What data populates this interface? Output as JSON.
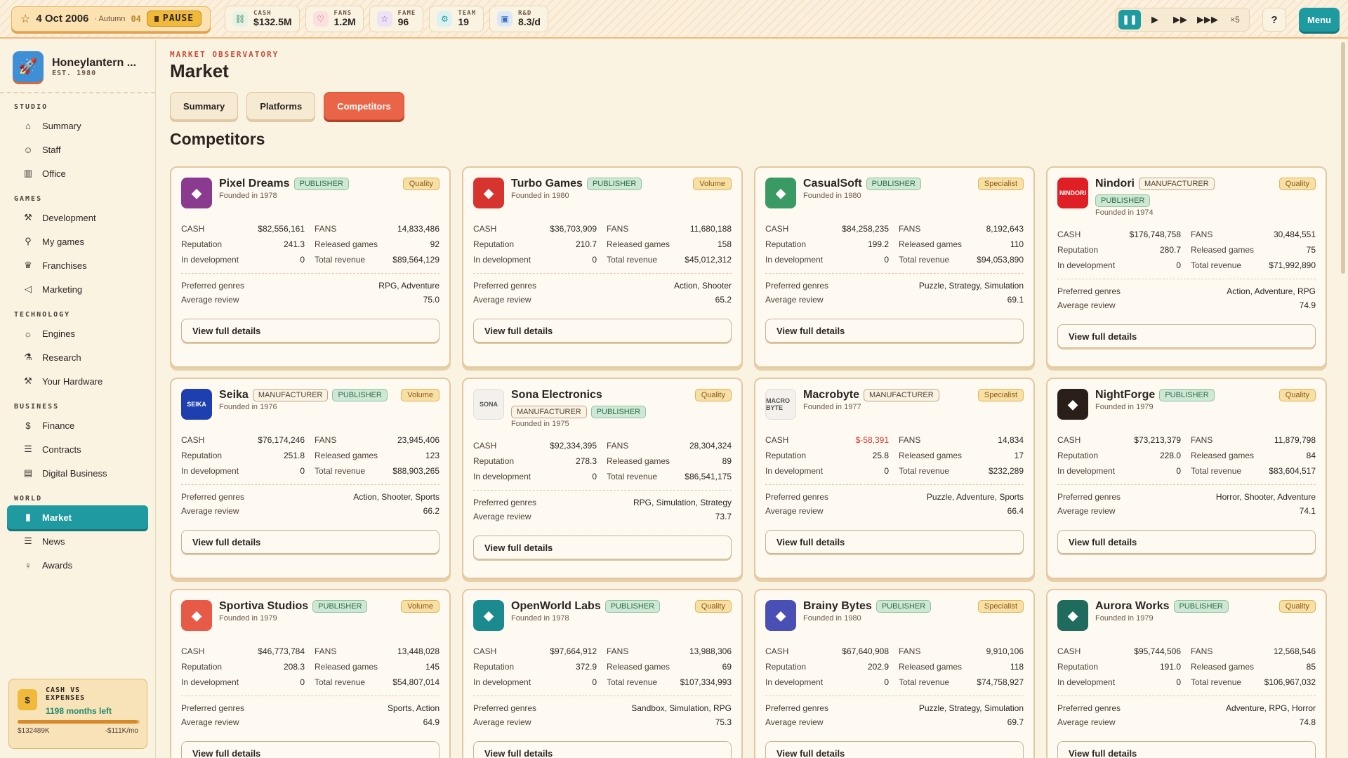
{
  "topbar": {
    "date": "4 Oct 2006",
    "season": "· Autumn",
    "week": "04",
    "pause": "PAUSE",
    "stats": [
      {
        "label": "CASH",
        "value": "$132.5M",
        "icon": "cash-icon",
        "color": "#e6f2e6"
      },
      {
        "label": "FANS",
        "value": "1.2M",
        "icon": "heart-icon",
        "color": "#fbe0e0"
      },
      {
        "label": "FAME",
        "value": "96",
        "icon": "star-icon",
        "color": "#ece3f5"
      },
      {
        "label": "TEAM",
        "value": "19",
        "icon": "team-icon",
        "color": "#ddf1f2"
      },
      {
        "label": "R&D",
        "value": "8.3/d",
        "icon": "research-icon",
        "color": "#dde8f7"
      }
    ],
    "speed_x5": "×5",
    "help": "?",
    "menu": "Menu"
  },
  "sidebar": {
    "studio_name": "Honeylantern ...",
    "studio_est": "EST. 1980",
    "sections": [
      {
        "title": "STUDIO",
        "items": [
          "Summary",
          "Staff",
          "Office"
        ]
      },
      {
        "title": "GAMES",
        "items": [
          "Development",
          "My games",
          "Franchises",
          "Marketing"
        ]
      },
      {
        "title": "TECHNOLOGY",
        "items": [
          "Engines",
          "Research",
          "Your Hardware"
        ]
      },
      {
        "title": "BUSINESS",
        "items": [
          "Finance",
          "Contracts",
          "Digital Business"
        ]
      },
      {
        "title": "WORLD",
        "items": [
          "Market",
          "News",
          "Awards"
        ]
      }
    ],
    "cash_widget": {
      "title": "CASH VS EXPENSES",
      "months": "1198 months left",
      "left": "$132489K",
      "right": "-$111K/mo",
      "progress": 0.98
    }
  },
  "main": {
    "eyebrow": "MARKET OBSERVATORY",
    "title": "Market",
    "tabs": [
      "Summary",
      "Platforms",
      "Competitors"
    ],
    "active_tab": "Competitors",
    "section": "Competitors"
  },
  "labels": {
    "cash": "CASH",
    "fans": "FANS",
    "reputation": "Reputation",
    "released": "Released games",
    "indev": "In development",
    "revenue": "Total revenue",
    "genres": "Preferred genres",
    "review": "Average review",
    "details": "View full details"
  },
  "competitors": [
    {
      "name": "Pixel Dreams",
      "badges": [
        "PUBLISHER"
      ],
      "founded": "Founded in 1978",
      "strategy": "Quality",
      "cash": "$82,556,161",
      "fans": "14,833,486",
      "reputation": "241.3",
      "released": "92",
      "indev": "0",
      "revenue": "$89,564,129",
      "genres": "RPG, Adventure",
      "review": "75.0",
      "color": "#8a3a8f"
    },
    {
      "name": "Turbo Games",
      "badges": [
        "PUBLISHER"
      ],
      "founded": "Founded in 1980",
      "strategy": "Volume",
      "cash": "$36,703,909",
      "fans": "11,680,188",
      "reputation": "210.7",
      "released": "158",
      "indev": "0",
      "revenue": "$45,012,312",
      "genres": "Action, Shooter",
      "review": "65.2",
      "color": "#d8342f"
    },
    {
      "name": "CasualSoft",
      "badges": [
        "PUBLISHER"
      ],
      "founded": "Founded in 1980",
      "strategy": "Specialist",
      "cash": "$84,258,235",
      "fans": "8,192,643",
      "reputation": "199.2",
      "released": "110",
      "indev": "0",
      "revenue": "$94,053,890",
      "genres": "Puzzle, Strategy, Simulation",
      "review": "69.1",
      "color": "#3a9a63"
    },
    {
      "name": "Nindori",
      "badges": [
        "MANUFACTURER",
        "PUBLISHER"
      ],
      "founded": "Founded in 1974",
      "strategy": "Quality",
      "cash": "$176,748,758",
      "fans": "30,484,551",
      "reputation": "280.7",
      "released": "75",
      "indev": "0",
      "revenue": "$71,992,890",
      "genres": "Action, Adventure, RPG",
      "review": "74.9",
      "color": "#e01e26",
      "logo_text": "NINDORI"
    },
    {
      "name": "Seika",
      "badges": [
        "MANUFACTURER",
        "PUBLISHER"
      ],
      "founded": "Founded in 1976",
      "strategy": "Volume",
      "cash": "$76,174,246",
      "fans": "23,945,406",
      "reputation": "251.8",
      "released": "123",
      "indev": "0",
      "revenue": "$88,903,265",
      "genres": "Action, Shooter, Sports",
      "review": "66.2",
      "color": "#1d3fb0",
      "logo_text": "SEIKA"
    },
    {
      "name": "Sona Electronics",
      "badges": [
        "MANUFACTURER",
        "PUBLISHER"
      ],
      "founded": "Founded in 1975",
      "strategy": "Quality",
      "cash": "$92,334,395",
      "fans": "28,304,324",
      "reputation": "278.3",
      "released": "89",
      "indev": "0",
      "revenue": "$86,541,175",
      "genres": "RPG, Simulation, Strategy",
      "review": "73.7",
      "color": "#f4f1ec",
      "logo_text": "SONA"
    },
    {
      "name": "Macrobyte",
      "badges": [
        "MANUFACTURER"
      ],
      "founded": "Founded in 1977",
      "strategy": "Specialist",
      "cash": "$-58,391",
      "cash_negative": true,
      "fans": "14,834",
      "reputation": "25.8",
      "released": "17",
      "indev": "0",
      "revenue": "$232,289",
      "genres": "Puzzle, Adventure, Sports",
      "review": "66.4",
      "color": "#f4f1ec",
      "logo_text": "MACRO BYTE"
    },
    {
      "name": "NightForge",
      "badges": [
        "PUBLISHER"
      ],
      "founded": "Founded in 1979",
      "strategy": "Quality",
      "cash": "$73,213,379",
      "fans": "11,879,798",
      "reputation": "228.0",
      "released": "84",
      "indev": "0",
      "revenue": "$83,604,517",
      "genres": "Horror, Shooter, Adventure",
      "review": "74.1",
      "color": "#2a1e18"
    },
    {
      "name": "Sportiva Studios",
      "badges": [
        "PUBLISHER"
      ],
      "founded": "Founded in 1979",
      "strategy": "Volume",
      "cash": "$46,773,784",
      "fans": "13,448,028",
      "reputation": "208.3",
      "released": "145",
      "indev": "0",
      "revenue": "$54,807,014",
      "genres": "Sports, Action",
      "review": "64.9",
      "color": "#e85a48"
    },
    {
      "name": "OpenWorld Labs",
      "badges": [
        "PUBLISHER"
      ],
      "founded": "Founded in 1978",
      "strategy": "Quality",
      "cash": "$97,664,912",
      "fans": "13,988,306",
      "reputation": "372.9",
      "released": "69",
      "indev": "0",
      "revenue": "$107,334,993",
      "genres": "Sandbox, Simulation, RPG",
      "review": "75.3",
      "color": "#1a8a8f"
    },
    {
      "name": "Brainy Bytes",
      "badges": [
        "PUBLISHER"
      ],
      "founded": "Founded in 1980",
      "strategy": "Specialist",
      "cash": "$67,640,908",
      "fans": "9,910,106",
      "reputation": "202.9",
      "released": "118",
      "indev": "0",
      "revenue": "$74,758,927",
      "genres": "Puzzle, Strategy, Simulation",
      "review": "69.7",
      "color": "#4a4fb5"
    },
    {
      "name": "Aurora Works",
      "badges": [
        "PUBLISHER"
      ],
      "founded": "Founded in 1979",
      "strategy": "Quality",
      "cash": "$95,744,506",
      "fans": "12,568,546",
      "reputation": "191.0",
      "released": "85",
      "indev": "0",
      "revenue": "$106,967,032",
      "genres": "Adventure, RPG, Horror",
      "review": "74.8",
      "color": "#1f6b5e"
    }
  ]
}
